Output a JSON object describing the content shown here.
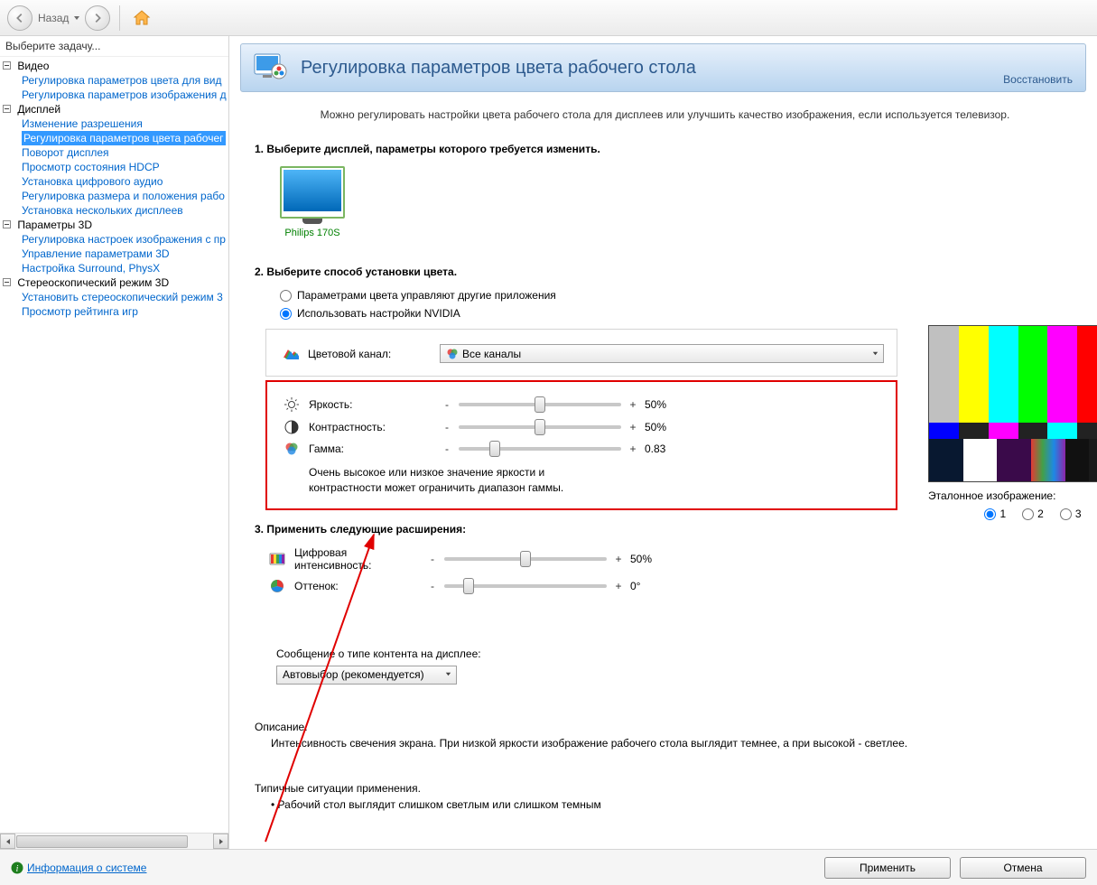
{
  "toolbar": {
    "back_label": "Назад"
  },
  "sidebar": {
    "task_label": "Выберите задачу...",
    "cats": [
      {
        "label": "Видео",
        "items": [
          "Регулировка параметров цвета для вид",
          "Регулировка параметров изображения д"
        ]
      },
      {
        "label": "Дисплей",
        "items": [
          "Изменение разрешения",
          "Регулировка параметров цвета рабочег",
          "Поворот дисплея",
          "Просмотр состояния HDCP",
          "Установка цифрового аудио",
          "Регулировка размера и положения рабо",
          "Установка нескольких дисплеев"
        ],
        "selected": 1
      },
      {
        "label": "Параметры 3D",
        "items": [
          "Регулировка настроек изображения с пр",
          "Управление параметрами 3D",
          "Настройка Surround, PhysX"
        ]
      },
      {
        "label": "Стереоскопический режим 3D",
        "items": [
          "Установить стереоскопический режим 3",
          "Просмотр рейтинга игр"
        ]
      }
    ]
  },
  "header": {
    "title": "Регулировка параметров цвета рабочего стола",
    "restore": "Восстановить"
  },
  "intro": "Можно регулировать настройки цвета рабочего стола для дисплеев или улучшить качество изображения, если используется телевизор.",
  "sec1": {
    "title": "1. Выберите дисплей, параметры которого требуется изменить.",
    "display_name": "Philips 170S"
  },
  "sec2": {
    "title": "2. Выберите способ установки цвета.",
    "radio_other": "Параметрами цвета управляют другие приложения",
    "radio_nvidia": "Использовать настройки NVIDIA",
    "channel_label": "Цветовой канал:",
    "channel_value": "Все каналы",
    "brightness_label": "Яркость:",
    "brightness_value": "50%",
    "brightness_pct": 50,
    "contrast_label": "Контрастность:",
    "contrast_value": "50%",
    "contrast_pct": 50,
    "gamma_label": "Гамма:",
    "gamma_value": "0.83",
    "gamma_pct": 22,
    "note1": "Очень высокое или низкое значение яркости и",
    "note2": "контрастности может ограничить диапазон гаммы."
  },
  "sec3": {
    "title": "3. Применить следующие расширения:",
    "vibrance_label": "Цифровая интенсивность:",
    "vibrance_value": "50%",
    "vibrance_pct": 50,
    "hue_label": "Оттенок:",
    "hue_value": "0°",
    "hue_pct": 15,
    "content_msg": "Сообщение о типе контента на дисплее:",
    "content_value": "Автовыбор (рекомендуется)"
  },
  "preview": {
    "label": "Эталонное изображение:",
    "opt1": "1",
    "opt2": "2",
    "opt3": "3"
  },
  "desc": {
    "h1": "Описание.",
    "t1": "Интенсивность свечения экрана. При низкой яркости изображение рабочего стола выглядит темнее, а при высокой - светлее.",
    "h2": "Типичные ситуации применения.",
    "t2": "• Рабочий стол выглядит слишком светлым или слишком темным"
  },
  "footer": {
    "sys": "Информация о системе",
    "apply": "Применить",
    "cancel": "Отмена"
  }
}
